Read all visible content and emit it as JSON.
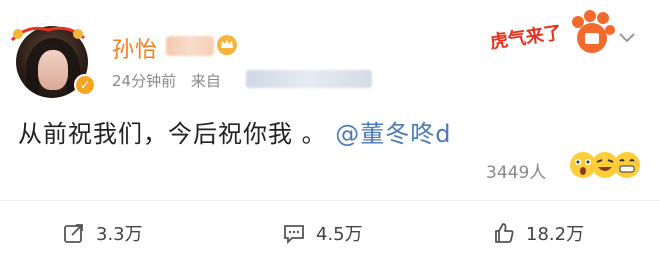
{
  "post": {
    "author_name": "孙怡",
    "timestamp": "24分钟前",
    "source_prefix": "来自",
    "text": "从前祝我们，今后祝你我 。",
    "mention": "@董冬咚d",
    "top_decoration_text": "虎气来了"
  },
  "reactions": {
    "count_label": "3449人"
  },
  "actions": {
    "repost_count": "3.3万",
    "comment_count": "4.5万",
    "like_count": "18.2万"
  },
  "icons": {
    "repost": "share-icon",
    "comment": "comment-icon",
    "like": "thumbs-up-icon",
    "more": "chevron-down-icon",
    "verified": "verified-badge-icon",
    "vip": "crown-icon"
  },
  "colors": {
    "name": "#f07f1a",
    "mention": "#4b79b6",
    "decor": "#e8321f"
  }
}
